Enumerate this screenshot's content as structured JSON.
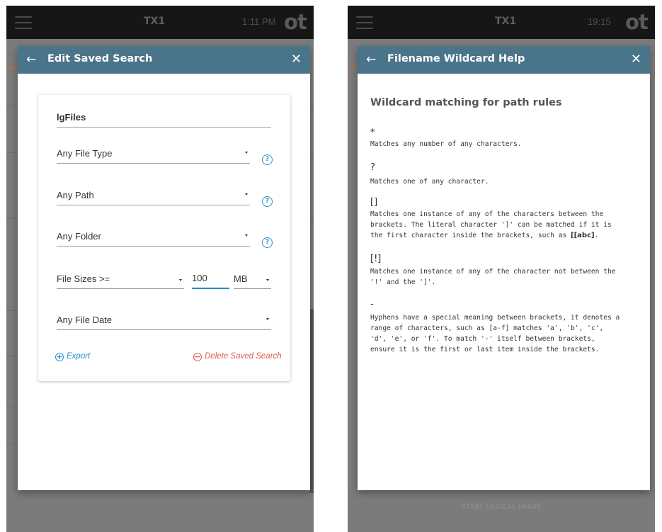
{
  "left_panel": {
    "topbar": {
      "device": "TX1",
      "time": "1:11 PM",
      "logo": "ot"
    },
    "dialog": {
      "title": "Edit Saved Search",
      "name_value": "lgFiles",
      "fields": [
        {
          "label": "Any File Type"
        },
        {
          "label": "Any Path"
        },
        {
          "label": "Any Folder"
        }
      ],
      "file_size": {
        "label": "File Sizes >=",
        "value": "100",
        "unit": "MB"
      },
      "file_date": "Any File Date",
      "help_icon": "?",
      "export_label": "Export",
      "delete_label": "Delete Saved Search"
    }
  },
  "right_panel": {
    "topbar": {
      "device": "TX1",
      "time": "19:15",
      "logo": "ot"
    },
    "dialog": {
      "title": "Filename Wildcard Help",
      "heading": "Wildcard matching for path rules",
      "items": [
        {
          "symbol": "*",
          "lines": [
            "Matches any number of any characters."
          ]
        },
        {
          "symbol": "?",
          "lines": [
            "Matches one of any character."
          ]
        },
        {
          "symbol": "[]",
          "lines": [
            "Matches one instance of any of the characters between the",
            "brackets. The literal character ']' can be matched if it is"
          ],
          "last_prefix": "the first character inside the brackets, such as ",
          "last_bold": "[[abc]",
          "last_suffix": "."
        },
        {
          "symbol": "[!]",
          "lines": [
            "Matches one instance of any of the character not between the",
            "'!' and the ']'."
          ]
        },
        {
          "symbol": "-",
          "lines": [
            "Hyphens have a special meaning between brackets, it denotes a",
            "range of characters, such as [a-f] matches 'a', 'b', 'c',",
            "'d', 'e', or 'f'. To match '-' itself between brackets,",
            "ensure it is the first or last item inside the brackets."
          ]
        }
      ]
    },
    "below_button": "START LOGICAL IMAGE"
  },
  "icons": {
    "menu": "hamburger-icon",
    "back": "arrow-left-icon",
    "close": "close-icon",
    "help": "question-circle-icon",
    "export": "plus-circle-icon",
    "delete": "minus-circle-icon"
  },
  "colors": {
    "header": "#4a7489",
    "accent_blue": "#2b8fc8",
    "delete_red": "#e05a4f"
  }
}
